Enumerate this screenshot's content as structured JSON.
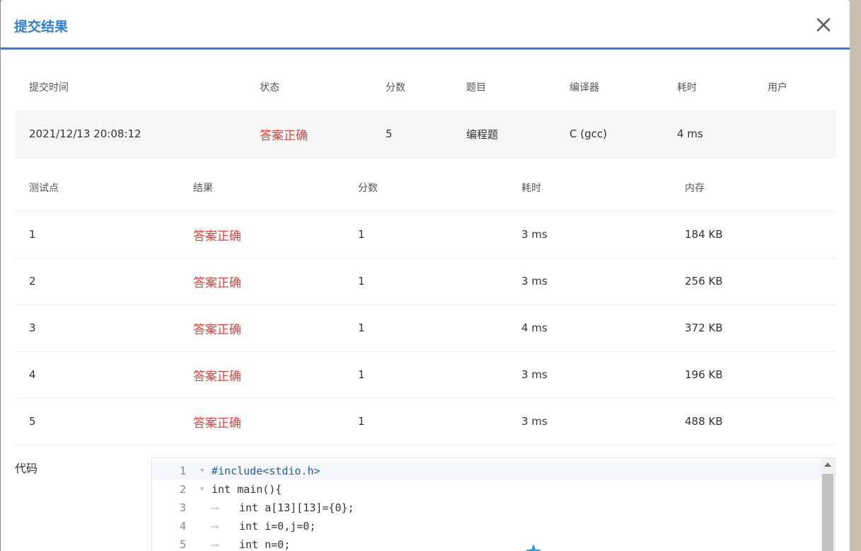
{
  "modal": {
    "title": "提交结果"
  },
  "summary": {
    "headers": [
      "提交时间",
      "状态",
      "分数",
      "题目",
      "编译器",
      "耗时",
      "用户"
    ],
    "row": {
      "time": "2021/12/13 20:08:12",
      "status": "答案正确",
      "score": "5",
      "problem": "编程题",
      "compiler": "C (gcc)",
      "elapsed": "4 ms",
      "user": ""
    }
  },
  "tests": {
    "headers": [
      "测试点",
      "结果",
      "分数",
      "耗时",
      "内存"
    ],
    "rows": [
      {
        "id": "1",
        "result": "答案正确",
        "score": "1",
        "time": "3 ms",
        "memory": "184 KB"
      },
      {
        "id": "2",
        "result": "答案正确",
        "score": "1",
        "time": "3 ms",
        "memory": "256 KB"
      },
      {
        "id": "3",
        "result": "答案正确",
        "score": "1",
        "time": "4 ms",
        "memory": "372 KB"
      },
      {
        "id": "4",
        "result": "答案正确",
        "score": "1",
        "time": "3 ms",
        "memory": "196 KB"
      },
      {
        "id": "5",
        "result": "答案正确",
        "score": "1",
        "time": "3 ms",
        "memory": "488 KB"
      }
    ]
  },
  "code": {
    "label": "代码",
    "lines": [
      {
        "num": "1",
        "text": "#include<stdio.h>"
      },
      {
        "num": "2",
        "text": "int main(){"
      },
      {
        "num": "3",
        "text": "int a[13][13]={0};"
      },
      {
        "num": "4",
        "text": "int i=0,j=0;"
      },
      {
        "num": "5",
        "text": "int n=0;"
      }
    ]
  },
  "colors": {
    "accent": "#2f7fd8",
    "success": "#e8413a"
  }
}
